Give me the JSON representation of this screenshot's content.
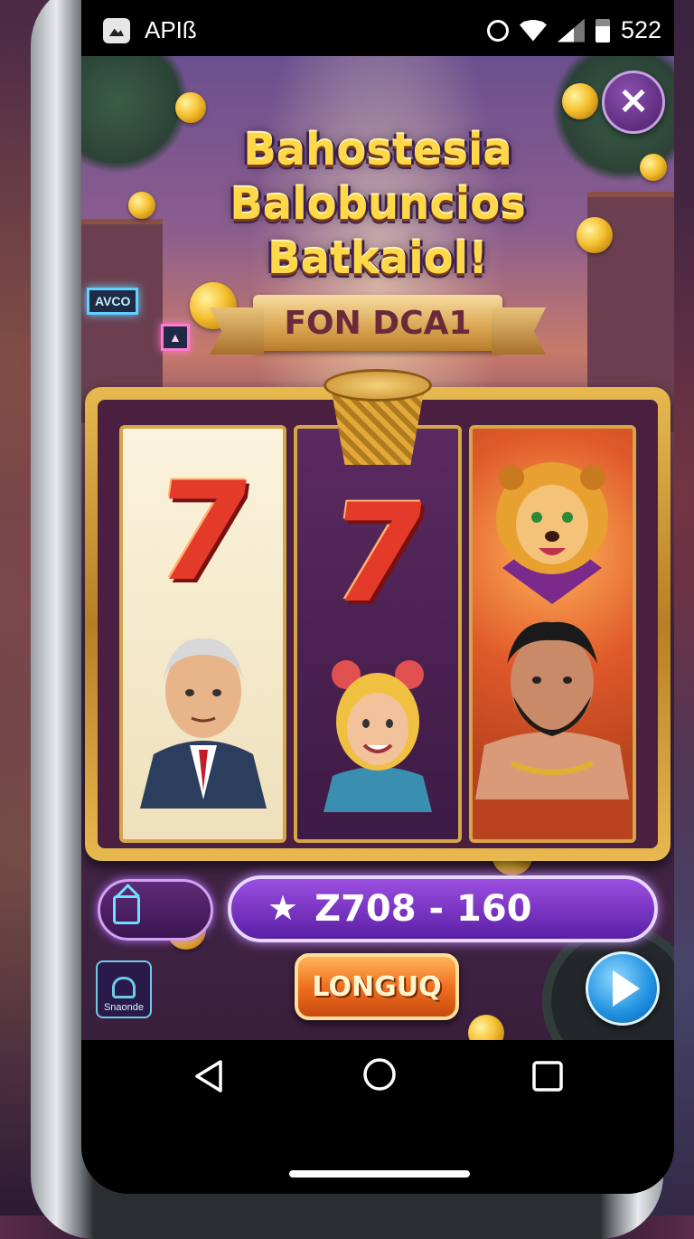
{
  "status_bar": {
    "app_name": "APIß",
    "battery_level": "522",
    "icons": [
      "image-icon",
      "alarm-icon",
      "wifi-icon",
      "signal-icon",
      "battery-icon"
    ]
  },
  "game": {
    "headline": [
      "Bahostesia",
      "Balobuncios",
      "Batkaiol!"
    ],
    "ribbon_label": "FON DCA1",
    "reels": [
      {
        "symbols": [
          "seven",
          "old-man-portrait"
        ]
      },
      {
        "symbols": [
          "seven",
          "girl-portrait"
        ]
      },
      {
        "symbols": [
          "lion-head",
          "bearded-man-portrait"
        ]
      }
    ],
    "score_text": "Z708 - 160",
    "sound_label": "Snaonde",
    "spin_label": "LONGUQ",
    "colors": {
      "gold": "#ffd84a",
      "purple": "#5b1fa6",
      "orange": "#f07020",
      "blue": "#1f8fe0"
    }
  },
  "nav_bar": {
    "icons": [
      "back-icon",
      "home-icon",
      "recents-icon"
    ]
  }
}
